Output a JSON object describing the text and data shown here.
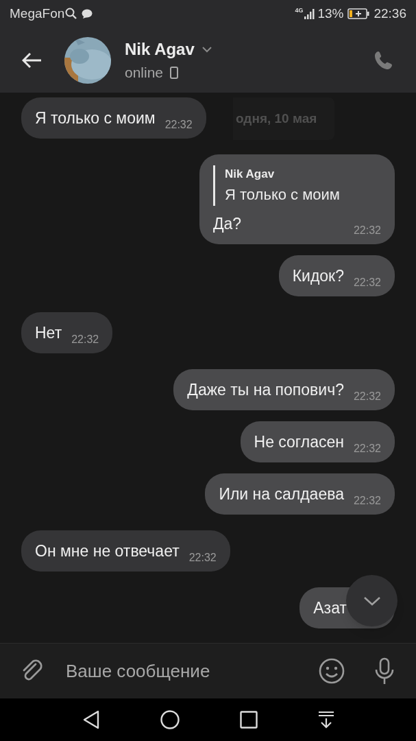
{
  "status_bar": {
    "carrier": "MegaFon",
    "network": "4G",
    "battery": "13%",
    "time": "22:36"
  },
  "header": {
    "name": "Nik Agav",
    "status": "online"
  },
  "date_chip": "одня, 10 мая",
  "messages": [
    {
      "kind": "incoming",
      "text": "Я только с моим",
      "time": "22:32"
    },
    {
      "kind": "outgoing",
      "reply": {
        "author": "Nik Agav",
        "text": "Я только с моим"
      },
      "text": "Да?",
      "time": "22:32"
    },
    {
      "kind": "outgoing",
      "text": "Кидок?",
      "time": "22:32"
    },
    {
      "kind": "incoming",
      "text": "Нет",
      "time": "22:32"
    },
    {
      "kind": "outgoing",
      "text": "Даже ты на попович?",
      "time": "22:32"
    },
    {
      "kind": "outgoing",
      "text": "Не согласен",
      "time": "22:32"
    },
    {
      "kind": "outgoing",
      "text": "Или на салдаева",
      "time": "22:32"
    },
    {
      "kind": "incoming",
      "text": "Он мне не отвечает",
      "time": "22:32"
    },
    {
      "kind": "outgoing",
      "text": "Азат"
    }
  ],
  "composer": {
    "placeholder": "Ваше сообщение"
  }
}
